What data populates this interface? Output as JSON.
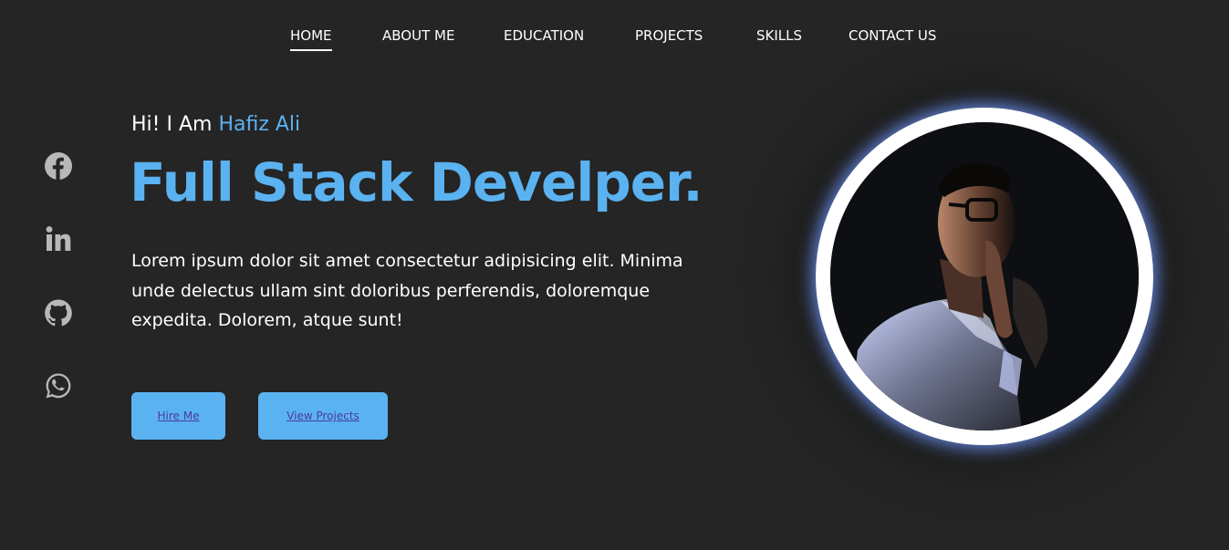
{
  "nav": {
    "items": [
      {
        "label": "HOME",
        "active": true
      },
      {
        "label": "ABOUT ME",
        "active": false
      },
      {
        "label": "EDUCATION",
        "active": false
      },
      {
        "label": "PROJECTS",
        "active": false
      },
      {
        "label": "SKILLS",
        "active": false
      },
      {
        "label": "CONTACT US",
        "active": false
      }
    ]
  },
  "social": [
    {
      "icon": "facebook-icon"
    },
    {
      "icon": "linkedin-icon"
    },
    {
      "icon": "github-icon"
    },
    {
      "icon": "whatsapp-icon"
    }
  ],
  "hero": {
    "greeting_prefix": "Hi! I Am ",
    "name": "Hafiz Ali",
    "headline": "Full Stack Develper.",
    "intro": "Lorem ipsum dolor sit amet consectetur adipisicing elit. Minima unde delectus ullam sint doloribus perferendis, doloremque expedita. Dolorem, atque sunt!",
    "buttons": {
      "hire": "Hire Me",
      "projects": "View Projects"
    }
  },
  "colors": {
    "background": "#252525",
    "accent": "#5bb2f0",
    "button_text": "#4a3aa8",
    "icon": "#b8b8b8",
    "glow": "#6e96ff"
  }
}
